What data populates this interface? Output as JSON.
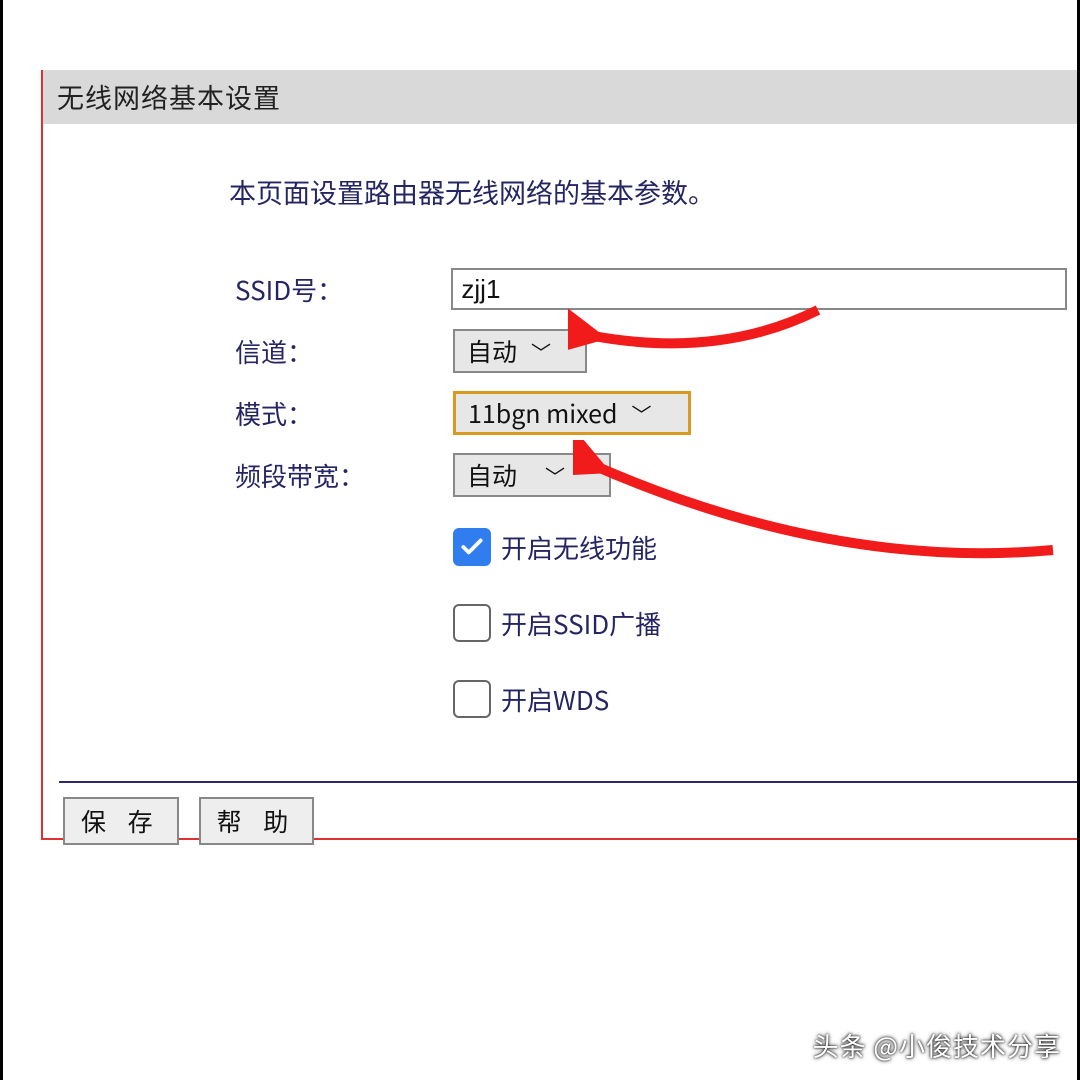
{
  "panel": {
    "title": "无线网络基本设置",
    "description": "本页面设置路由器无线网络的基本参数。"
  },
  "form": {
    "ssid_label": "SSID号：",
    "ssid_value": "zjj1",
    "channel_label": "信道：",
    "channel_value": "自动",
    "mode_label": "模式：",
    "mode_value": "11bgn mixed",
    "bandwidth_label": "频段带宽：",
    "bandwidth_value": "自动",
    "enable_wifi_label": "开启无线功能",
    "enable_wifi_checked": true,
    "enable_ssid_label": "开启SSID广播",
    "enable_ssid_checked": false,
    "enable_wds_label": "开启WDS",
    "enable_wds_checked": false
  },
  "buttons": {
    "save": "保 存",
    "help": "帮 助"
  },
  "watermark": "头条 @小俊技术分享"
}
